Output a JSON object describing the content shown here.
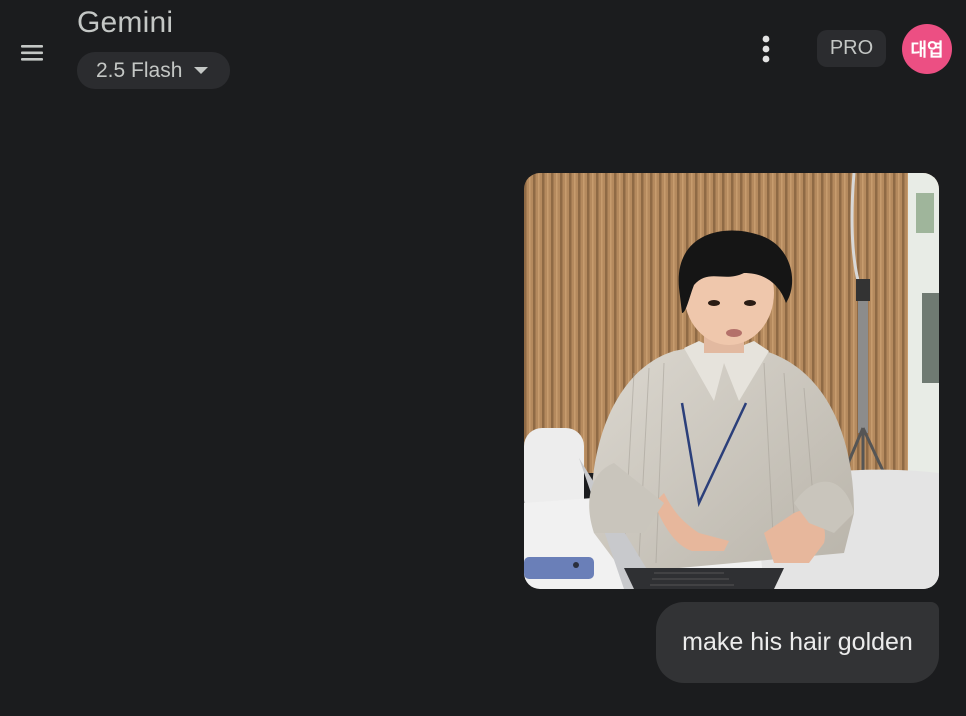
{
  "header": {
    "title": "Gemini",
    "model": "2.5 Flash",
    "pro_label": "PRO",
    "avatar_text": "대엽"
  },
  "chat": {
    "user_image_alt": "Photo of a man in a striped shirt with a lanyard, gesturing at a laptop on a table",
    "user_message": "make his hair golden"
  },
  "icons": {
    "menu": "menu-icon",
    "dropdown": "dropdown-caret-icon",
    "more": "more-vert-icon"
  },
  "colors": {
    "background": "#1b1c1e",
    "chip": "#2b2c2f",
    "bubble": "#323335",
    "avatar": "#ec4f83"
  }
}
